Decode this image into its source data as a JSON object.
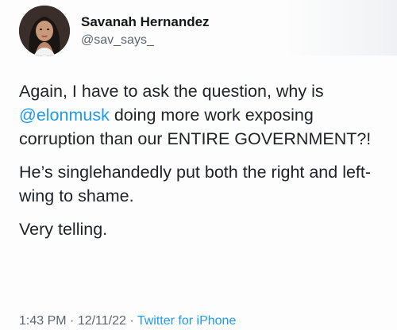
{
  "author": {
    "display_name": "Savanah Hernandez",
    "handle": "@sav_says_"
  },
  "tweet": {
    "para1_before": "Again, I have to ask the question, why is ",
    "mention": "@elonmusk",
    "para1_after": " doing more work exposing corruption than our ENTIRE GOVERNMENT?!",
    "para2": "He’s singlehandedly put both the right and left-wing to shame.",
    "para3": "Very telling."
  },
  "meta": {
    "time": "1:43 PM",
    "separator1": " · ",
    "date": "12/11/22",
    "separator2": " · ",
    "source": "Twitter for iPhone"
  },
  "icons": {
    "avatar": "profile-photo"
  },
  "colors": {
    "link": "#1d9bf0",
    "secondary_text": "#5b6670",
    "primary_text": "#1f2327"
  }
}
